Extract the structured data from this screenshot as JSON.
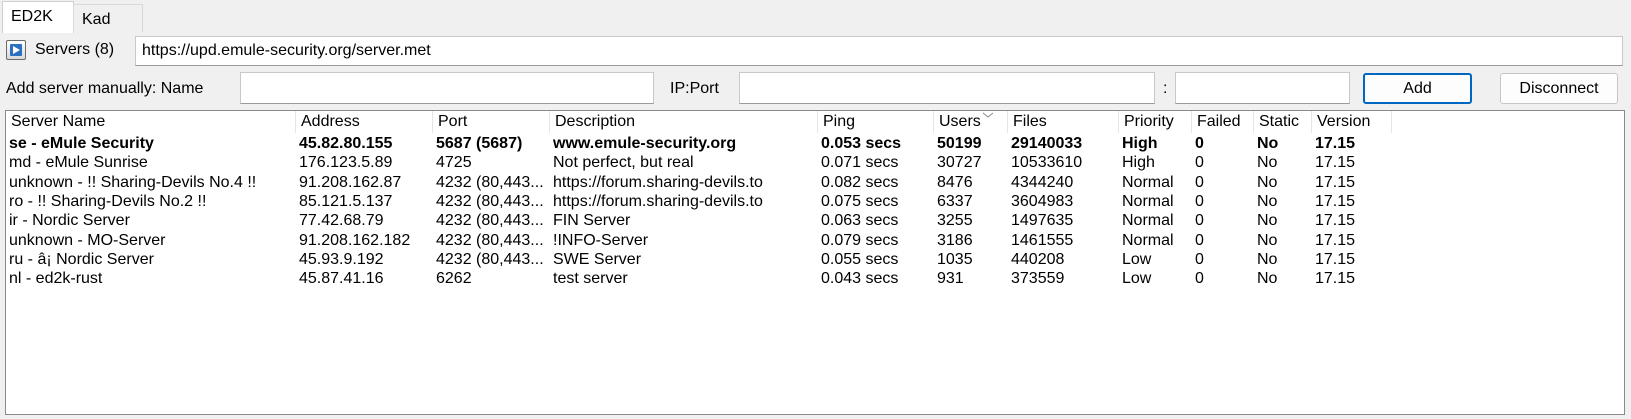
{
  "tabs": [
    {
      "label": "ED2K",
      "active": true
    },
    {
      "label": "Kad",
      "active": false
    }
  ],
  "server_list": {
    "label": "Servers (8)",
    "url": "https://upd.emule-security.org/server.met"
  },
  "add_server": {
    "label": "Add server manually: Name",
    "name_value": "",
    "ipport_label": "IP:Port",
    "ip_value": "",
    "colon": ":",
    "port_value": "",
    "add_button": "Add",
    "disconnect_button": "Disconnect"
  },
  "table": {
    "columns": [
      "Server Name",
      "Address",
      "Port",
      "Description",
      "Ping",
      "Users",
      "Files",
      "Priority",
      "Failed",
      "Static",
      "Version"
    ],
    "rows": [
      {
        "bold": true,
        "cells": [
          "se - eMule Security",
          "45.82.80.155",
          "5687 (5687)",
          "www.emule-security.org",
          "0.053 secs",
          "50199",
          "29140033",
          "High",
          "0",
          "No",
          "17.15"
        ]
      },
      {
        "bold": false,
        "cells": [
          "md - eMule Sunrise",
          "176.123.5.89",
          "4725",
          "Not perfect, but real",
          "0.071 secs",
          "30727",
          "10533610",
          "High",
          "0",
          "No",
          "17.15"
        ]
      },
      {
        "bold": false,
        "cells": [
          "unknown - !! Sharing-Devils No.4 !!",
          "91.208.162.87",
          "4232 (80,443...",
          "https://forum.sharing-devils.to",
          "0.082 secs",
          "8476",
          "4344240",
          "Normal",
          "0",
          "No",
          "17.15"
        ]
      },
      {
        "bold": false,
        "cells": [
          "ro - !! Sharing-Devils No.2 !!",
          "85.121.5.137",
          "4232 (80,443...",
          "https://forum.sharing-devils.to",
          "0.075 secs",
          "6337",
          "3604983",
          "Normal",
          "0",
          "No",
          "17.15"
        ]
      },
      {
        "bold": false,
        "cells": [
          "ir - Nordic Server",
          "77.42.68.79",
          "4232 (80,443...",
          "FIN Server",
          "0.063 secs",
          "3255",
          "1497635",
          "Normal",
          "0",
          "No",
          "17.15"
        ]
      },
      {
        "bold": false,
        "cells": [
          "unknown - MO-Server",
          "91.208.162.182",
          "4232 (80,443...",
          "!INFO-Server",
          "0.079 secs",
          "3186",
          "1461555",
          "Normal",
          "0",
          "No",
          "17.15"
        ]
      },
      {
        "bold": false,
        "cells": [
          "ru - â¡ Nordic Server",
          "45.93.9.192",
          "4232 (80,443...",
          "SWE Server",
          "0.055 secs",
          "1035",
          "440208",
          "Low",
          "0",
          "No",
          "17.15"
        ]
      },
      {
        "bold": false,
        "cells": [
          "nl - ed2k-rust",
          "45.87.41.16",
          "6262",
          "test server",
          "0.043 secs",
          "931",
          "373559",
          "Low",
          "0",
          "No",
          "17.15"
        ]
      }
    ]
  },
  "icons": {
    "connect": "play-icon",
    "sort": "sort-descending-icon"
  }
}
